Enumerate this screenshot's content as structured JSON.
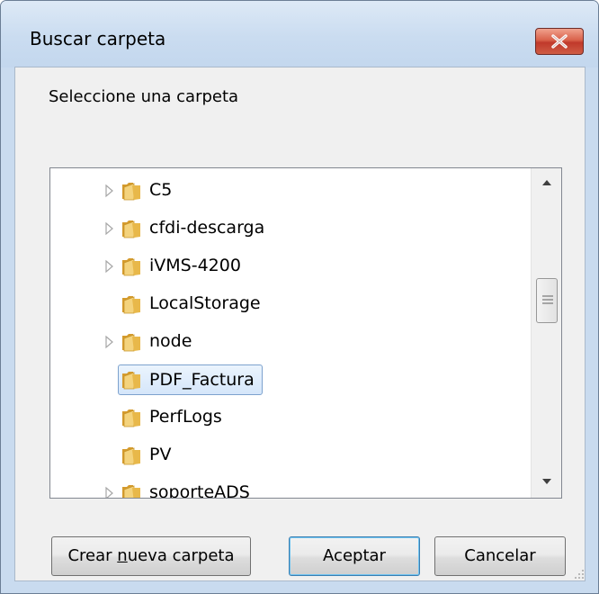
{
  "window": {
    "title": "Buscar carpeta"
  },
  "dialog": {
    "prompt": "Seleccione una carpeta"
  },
  "tree": {
    "items": [
      {
        "label": "C5",
        "expandable": true,
        "selected": false
      },
      {
        "label": "cfdi-descarga",
        "expandable": true,
        "selected": false
      },
      {
        "label": "iVMS-4200",
        "expandable": true,
        "selected": false
      },
      {
        "label": "LocalStorage",
        "expandable": false,
        "selected": false
      },
      {
        "label": "node",
        "expandable": true,
        "selected": false
      },
      {
        "label": "PDF_Factura",
        "expandable": false,
        "selected": true
      },
      {
        "label": "PerfLogs",
        "expandable": false,
        "selected": false
      },
      {
        "label": "PV",
        "expandable": false,
        "selected": false
      },
      {
        "label": "soporteADS",
        "expandable": true,
        "selected": false
      }
    ],
    "scroll_position": 0.45
  },
  "buttons": {
    "new_folder_pre": "Crear ",
    "new_folder_mnemonic": "n",
    "new_folder_post": "ueva carpeta",
    "ok": "Aceptar",
    "cancel": "Cancelar"
  },
  "colors": {
    "selection_border": "#7da2ce",
    "selection_fill": "#d5e6fa",
    "close_button": "#c0392b",
    "folder": "#e8b84a"
  }
}
